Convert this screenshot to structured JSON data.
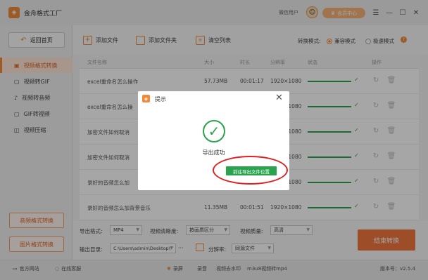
{
  "app": {
    "title": "金舟格式工厂",
    "user": "微信用户",
    "vip_label": "会员中心",
    "win_menu": "☰",
    "win_min": "—",
    "win_max": "☐",
    "win_close": "✕"
  },
  "sidebar": {
    "back_label": "返回首页",
    "items": [
      {
        "label": "视频格式转换",
        "icon": "▣"
      },
      {
        "label": "视频转GIF",
        "icon": "▢"
      },
      {
        "label": "视频转音频",
        "icon": "♪"
      },
      {
        "label": "GIF转视频",
        "icon": "▢"
      },
      {
        "label": "视频压缩",
        "icon": "◫"
      }
    ],
    "audio_btn": "音频格式转换",
    "image_btn": "图片格式转换"
  },
  "toolbar": {
    "add_file": "添加文件",
    "add_folder": "添加文件夹",
    "clear_list": "清空列表",
    "mode_label": "转换模式:",
    "mode_compat": "兼容模式",
    "mode_fast": "极速模式",
    "help": "?"
  },
  "table": {
    "headers": [
      "文件名称",
      "大小",
      "时长",
      "分辨率",
      "状态",
      "操作"
    ],
    "rows": [
      {
        "name": "excel重命名怎么操作",
        "size": "57.73MB",
        "duration": "00:01:17",
        "resolution": "1920×1080"
      },
      {
        "name": "excel重命名怎么操",
        "size": "",
        "duration": "",
        "resolution": "1920×1080"
      },
      {
        "name": "加密文件如何取消",
        "size": "",
        "duration": "",
        "resolution": "1920×1080"
      },
      {
        "name": "加密文件如何取消",
        "size": "",
        "duration": "",
        "resolution": "1920×1080"
      },
      {
        "name": "录好的音频怎么加",
        "size": "",
        "duration": "",
        "resolution": "1920×1080"
      },
      {
        "name": "录好的音频怎么加背景音乐",
        "size": "11.35MB",
        "duration": "00:01:51",
        "resolution": "1920×1080"
      }
    ]
  },
  "bottom": {
    "format_label": "导出格式:",
    "format_value": "MP4",
    "clarity_label": "视频清晰度:",
    "clarity_value": "按画质区分",
    "quality_label": "视频质量:",
    "quality_value": "高清",
    "dir_label": "输出目录:",
    "dir_value": "C:\\Users\\admin\\Desktop\\",
    "dir_more": "···",
    "res_label": "分辨率:",
    "res_value": "同源文件",
    "start_btn": "结束转换"
  },
  "status": {
    "site": "官方网站",
    "service": "在线客服",
    "tools": [
      "录屏",
      "录音",
      "视频去水印",
      "m3u8视频转mp4"
    ],
    "version": "版本号：v2.5.4"
  },
  "dialog": {
    "title": "提示",
    "message": "导出成功",
    "action": "前往导出文件位置"
  },
  "colors": {
    "accent": "#f08a3a",
    "success": "#29a34d",
    "annotation": "#e02020"
  }
}
